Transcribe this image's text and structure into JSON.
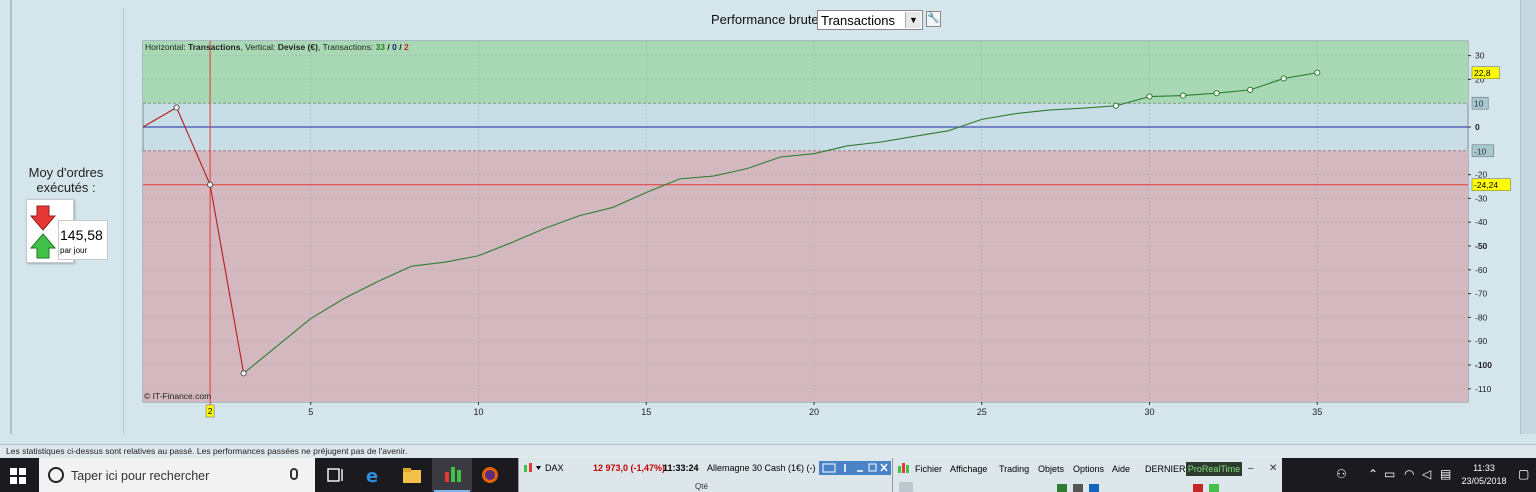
{
  "header": {
    "perf_label": "Performance brute",
    "select_value": "Transactions"
  },
  "stats": {
    "title": "Moy d'ordres exécutés :",
    "value": "145,58",
    "unit": "par jour"
  },
  "chart_info": {
    "prefix": "Horizontal: ",
    "horizontal": "Transactions",
    "mid": ", Vertical: ",
    "vertical": "Devise (€)",
    "tx_label": ", Transactions: ",
    "tx_total": "33",
    "sep": " / ",
    "tx_zero": "0",
    "tx_neg": "2"
  },
  "copyright": "© IT-Finance.com",
  "chart_data": {
    "type": "line",
    "x": [
      0,
      1,
      2,
      3,
      4,
      5,
      6,
      7,
      8,
      9,
      10,
      11,
      12,
      13,
      14,
      15,
      16,
      17,
      18,
      19,
      20,
      21,
      22,
      23,
      24,
      25,
      26,
      27,
      28,
      29,
      30,
      31,
      32,
      33,
      34,
      35
    ],
    "y": [
      0,
      8.2,
      -24.24,
      -103.5,
      -92,
      -80.5,
      -72,
      -64.9,
      -58.5,
      -56.8,
      -54.1,
      -48.5,
      -42.5,
      -37.3,
      -33.8,
      -27.5,
      -21.8,
      -20.6,
      -17.5,
      -12.6,
      -11.2,
      -7.9,
      -6.3,
      -3.9,
      -1.6,
      3.2,
      5.6,
      7.1,
      7.9,
      8.9,
      12.8,
      13.2,
      14.2,
      15.6,
      20.4,
      22.8
    ],
    "loss_segment_end": 3,
    "marker_x": [
      1,
      2,
      3,
      29,
      30,
      31,
      32,
      33,
      34,
      35
    ],
    "xlim": [
      0,
      39
    ],
    "ylim": [
      -115,
      33
    ],
    "xticks": [
      5,
      10,
      15,
      20,
      25,
      30,
      35
    ],
    "yticks": [
      30,
      20,
      0,
      -20,
      -30,
      -40,
      -50,
      -60,
      -70,
      -80,
      -90,
      -100,
      -110
    ],
    "bold_yticks": [
      0,
      -50,
      -100
    ],
    "upper_band": 10,
    "lower_band": -10,
    "current_value": 22.8,
    "min_line": -24.24,
    "cursor_x": 2,
    "labels": {
      "current": "22,8",
      "upper": "10",
      "lower": "-10",
      "min": "-24,24",
      "cursor": "2"
    },
    "colors": {
      "profit_zone": "#a8d8b4",
      "loss_zone": "#d4b8c0",
      "neutral_zone": "#c9dde6",
      "profit_line": "#2e7d32",
      "loss_line": "#b71c1c",
      "zero_line": "#3f51b5",
      "min_line": "#e53935"
    },
    "grid": true
  },
  "status_bar": "Les statistiques ci-dessus sont relatives au passé. Les performances passées ne préjugent pas de l'avenir.",
  "taskbar": {
    "search_placeholder": "Taper ici pour rechercher",
    "dax": {
      "name": "DAX",
      "value": "12 973,0 (-1,47%)",
      "time": "11:33:24",
      "desc": "Allemagne 30 Cash (1€) (-)",
      "sub": "Qté"
    },
    "prt_menu": [
      "Fichier",
      "Affichage",
      "Trading",
      "Objets",
      "Options",
      "Aide"
    ],
    "prt_dernier": "DERNIER",
    "prt_badge": "ProRealTime",
    "clock_time": "11:33",
    "clock_date": "23/05/2018"
  }
}
